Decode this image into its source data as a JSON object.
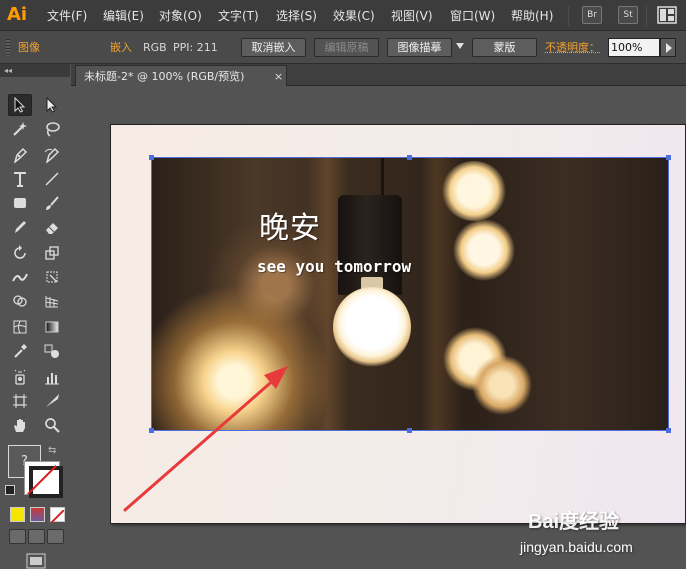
{
  "app": {
    "logo": "Ai",
    "menu": [
      "文件(F)",
      "编辑(E)",
      "对象(O)",
      "文字(T)",
      "选择(S)",
      "效果(C)",
      "视图(V)",
      "窗口(W)",
      "帮助(H)"
    ],
    "bridge_button": "Br",
    "stock_button": "St"
  },
  "control_bar": {
    "object_type": "图像",
    "embed_label": "嵌入",
    "color_mode": "RGB",
    "ppi": "PPI: 211",
    "unembed_button": "取消嵌入",
    "edit_original_button": "编辑原稿",
    "image_trace_button": "图像描摹",
    "mask_button": "蒙版",
    "opacity_label": "不透明度：",
    "opacity_value": "100%"
  },
  "document": {
    "tab_title": "未标题-2* @ 100% (RGB/预览)",
    "close": "×"
  },
  "artwork": {
    "title": "晚安",
    "subtitle": "see you tomorrow"
  },
  "tools": {
    "fill_unknown": "?",
    "swap": "⇆"
  },
  "colors": {
    "accent_orange": "#f0a030",
    "selection_blue": "#4d6ede",
    "annotation_arrow": "#e83a3a"
  },
  "watermark": {
    "logo": "Bai度经验",
    "url": "jingyan.baidu.com"
  }
}
